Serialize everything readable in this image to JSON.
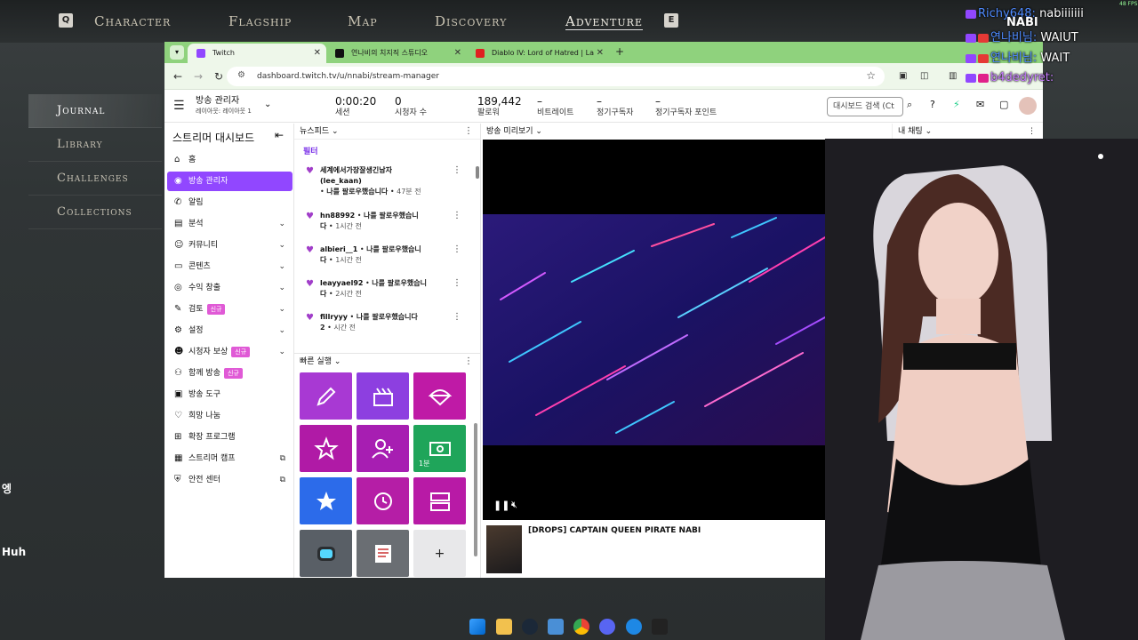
{
  "game": {
    "nav_key_left": "Q",
    "nav_key_right": "E",
    "nav": [
      "Character",
      "Flagship",
      "Map",
      "Discovery",
      "Adventure"
    ],
    "active_nav": "Adventure",
    "menu": [
      "Journal",
      "Library",
      "Challenges",
      "Collections"
    ],
    "active_menu": "Journal",
    "side_text_1": "엥",
    "side_text_2": "Huh",
    "fps": "48 FPS",
    "hud_name": "NABI"
  },
  "browser": {
    "tabs": [
      {
        "label": "Twitch",
        "active": true,
        "icon_color": "#9147ff"
      },
      {
        "label": "연나비의 치지직 스튜디오",
        "active": false,
        "icon_color": "#111111"
      },
      {
        "label": "Diablo IV: Lord of Hatred | La",
        "active": false,
        "icon_color": "#e02020"
      }
    ],
    "new_tab": "+",
    "url": "dashboard.twitch.tv/u/nnabi/stream-manager"
  },
  "twitch": {
    "layout_title": "방송 관리자",
    "layout_sub": "레이아웃: 레이아웃 1",
    "stats": [
      {
        "value": "0:00:20",
        "label": "세션"
      },
      {
        "value": "0",
        "label": "시청자 수"
      },
      {
        "value": "189,442",
        "label": "팔로워"
      },
      {
        "value": "–",
        "label": "비트레이트"
      },
      {
        "value": "–",
        "label": "정기구독자"
      },
      {
        "value": "–",
        "label": "정기구독자 포인트"
      }
    ],
    "search_placeholder": "대시보드 검색 (Ct",
    "sidebar_title": "스트리머 대시보드",
    "nav": [
      {
        "label": "홈",
        "icon": "home-icon",
        "chevron": false,
        "badge": "",
        "external": false
      },
      {
        "label": "방송 관리자",
        "icon": "broadcast-icon",
        "chevron": false,
        "badge": "",
        "external": false,
        "active": true
      },
      {
        "label": "알림",
        "icon": "megaphone-icon",
        "chevron": false,
        "badge": "",
        "external": false
      },
      {
        "label": "분석",
        "icon": "analytics-icon",
        "chevron": true,
        "badge": "",
        "external": false
      },
      {
        "label": "커뮤니티",
        "icon": "community-icon",
        "chevron": true,
        "badge": "",
        "external": false
      },
      {
        "label": "콘텐츠",
        "icon": "content-icon",
        "chevron": true,
        "badge": "",
        "external": false
      },
      {
        "label": "수익 창출",
        "icon": "monetization-icon",
        "chevron": true,
        "badge": "",
        "external": false
      },
      {
        "label": "검토",
        "icon": "review-icon",
        "chevron": true,
        "badge": "신규",
        "external": false
      },
      {
        "label": "설정",
        "icon": "settings-icon",
        "chevron": true,
        "badge": "",
        "external": false
      },
      {
        "label": "시청자 보상",
        "icon": "rewards-icon",
        "chevron": true,
        "badge": "신규",
        "external": false
      },
      {
        "label": "함께 방송",
        "icon": "collab-icon",
        "chevron": false,
        "badge": "신규",
        "external": false
      },
      {
        "label": "방송 도구",
        "icon": "tools-icon",
        "chevron": false,
        "badge": "",
        "external": false
      },
      {
        "label": "희망 나눔",
        "icon": "charity-icon",
        "chevron": false,
        "badge": "",
        "external": false
      },
      {
        "label": "확장 프로그램",
        "icon": "extensions-icon",
        "chevron": false,
        "badge": "",
        "external": false
      },
      {
        "label": "스트리머 캠프",
        "icon": "camp-icon",
        "chevron": false,
        "badge": "",
        "external": true
      },
      {
        "label": "안전 센터",
        "icon": "shield-icon",
        "chevron": false,
        "badge": "",
        "external": true
      }
    ],
    "feed_title": "뉴스피드",
    "feed_filter": "필터",
    "feed": [
      {
        "name": "세계에서가장잘생긴남자",
        "line2": "(lee_kaan)",
        "action": "나를 팔로우했습니다",
        "time": "47분 전"
      },
      {
        "name": "hn88992",
        "action": "나를 팔로우했습니",
        "action2": "다",
        "time": "1시간 전"
      },
      {
        "name": "albieri__1",
        "action": "나를 팔로우했습니",
        "action2": "다",
        "time": "1시간 전"
      },
      {
        "name": "leayyael92",
        "action": "나를 팔로우했습니",
        "action2": "다",
        "time": "2시간 전"
      },
      {
        "name": "fillryyy",
        "action": "나를 팔로우했습니다",
        "action2": "2",
        "time": "시간 전"
      }
    ],
    "quick_title": "빠른 실행",
    "quick_actions": [
      {
        "name": "edit-stream-info",
        "color": "#a839d3",
        "icon": "pencil-icon",
        "label": ""
      },
      {
        "name": "clip-action",
        "color": "#8d3fe0",
        "icon": "clapper-icon",
        "label": ""
      },
      {
        "name": "ad-action",
        "color": "#bf1aa6",
        "icon": "parachute-icon",
        "label": ""
      },
      {
        "name": "highlight-action",
        "color": "#b01aa6",
        "icon": "star-icon",
        "label": ""
      },
      {
        "name": "add-mod-action",
        "color": "#a71eb2",
        "icon": "user-plus-icon",
        "label": ""
      },
      {
        "name": "run-ad-action",
        "color": "#1fa55a",
        "icon": "cash-icon",
        "label": "1분"
      },
      {
        "name": "favorite-action",
        "color": "#2c6bea",
        "icon": "star-filled-icon",
        "label": ""
      },
      {
        "name": "marker-action",
        "color": "#b51ea6",
        "icon": "replay-icon",
        "label": ""
      },
      {
        "name": "layout-action",
        "color": "#b81aa6",
        "icon": "layout-icon",
        "label": ""
      },
      {
        "name": "ext-action-1",
        "color": "#595f66",
        "icon": "discord-icon",
        "label": ""
      },
      {
        "name": "ext-action-2",
        "color": "#6a6e73",
        "icon": "note-icon",
        "label": ""
      },
      {
        "name": "add-action",
        "color": "#e8e8ea",
        "icon": "plus-icon",
        "label": "+"
      }
    ],
    "preview_title": "방송 미리보기",
    "chat_title": "내 채팅",
    "stream_title": "[DROPS] CAPTAIN QUEEN PIRATE NABI"
  },
  "chat": [
    {
      "name": "Richy648:",
      "msg": "nabiiiiiii"
    },
    {
      "name": "연나비님:",
      "msg": "WAIUT"
    },
    {
      "name": "연나비님:",
      "msg": "WAIT"
    },
    {
      "name": "b4dedyret:",
      "msg": ""
    }
  ]
}
